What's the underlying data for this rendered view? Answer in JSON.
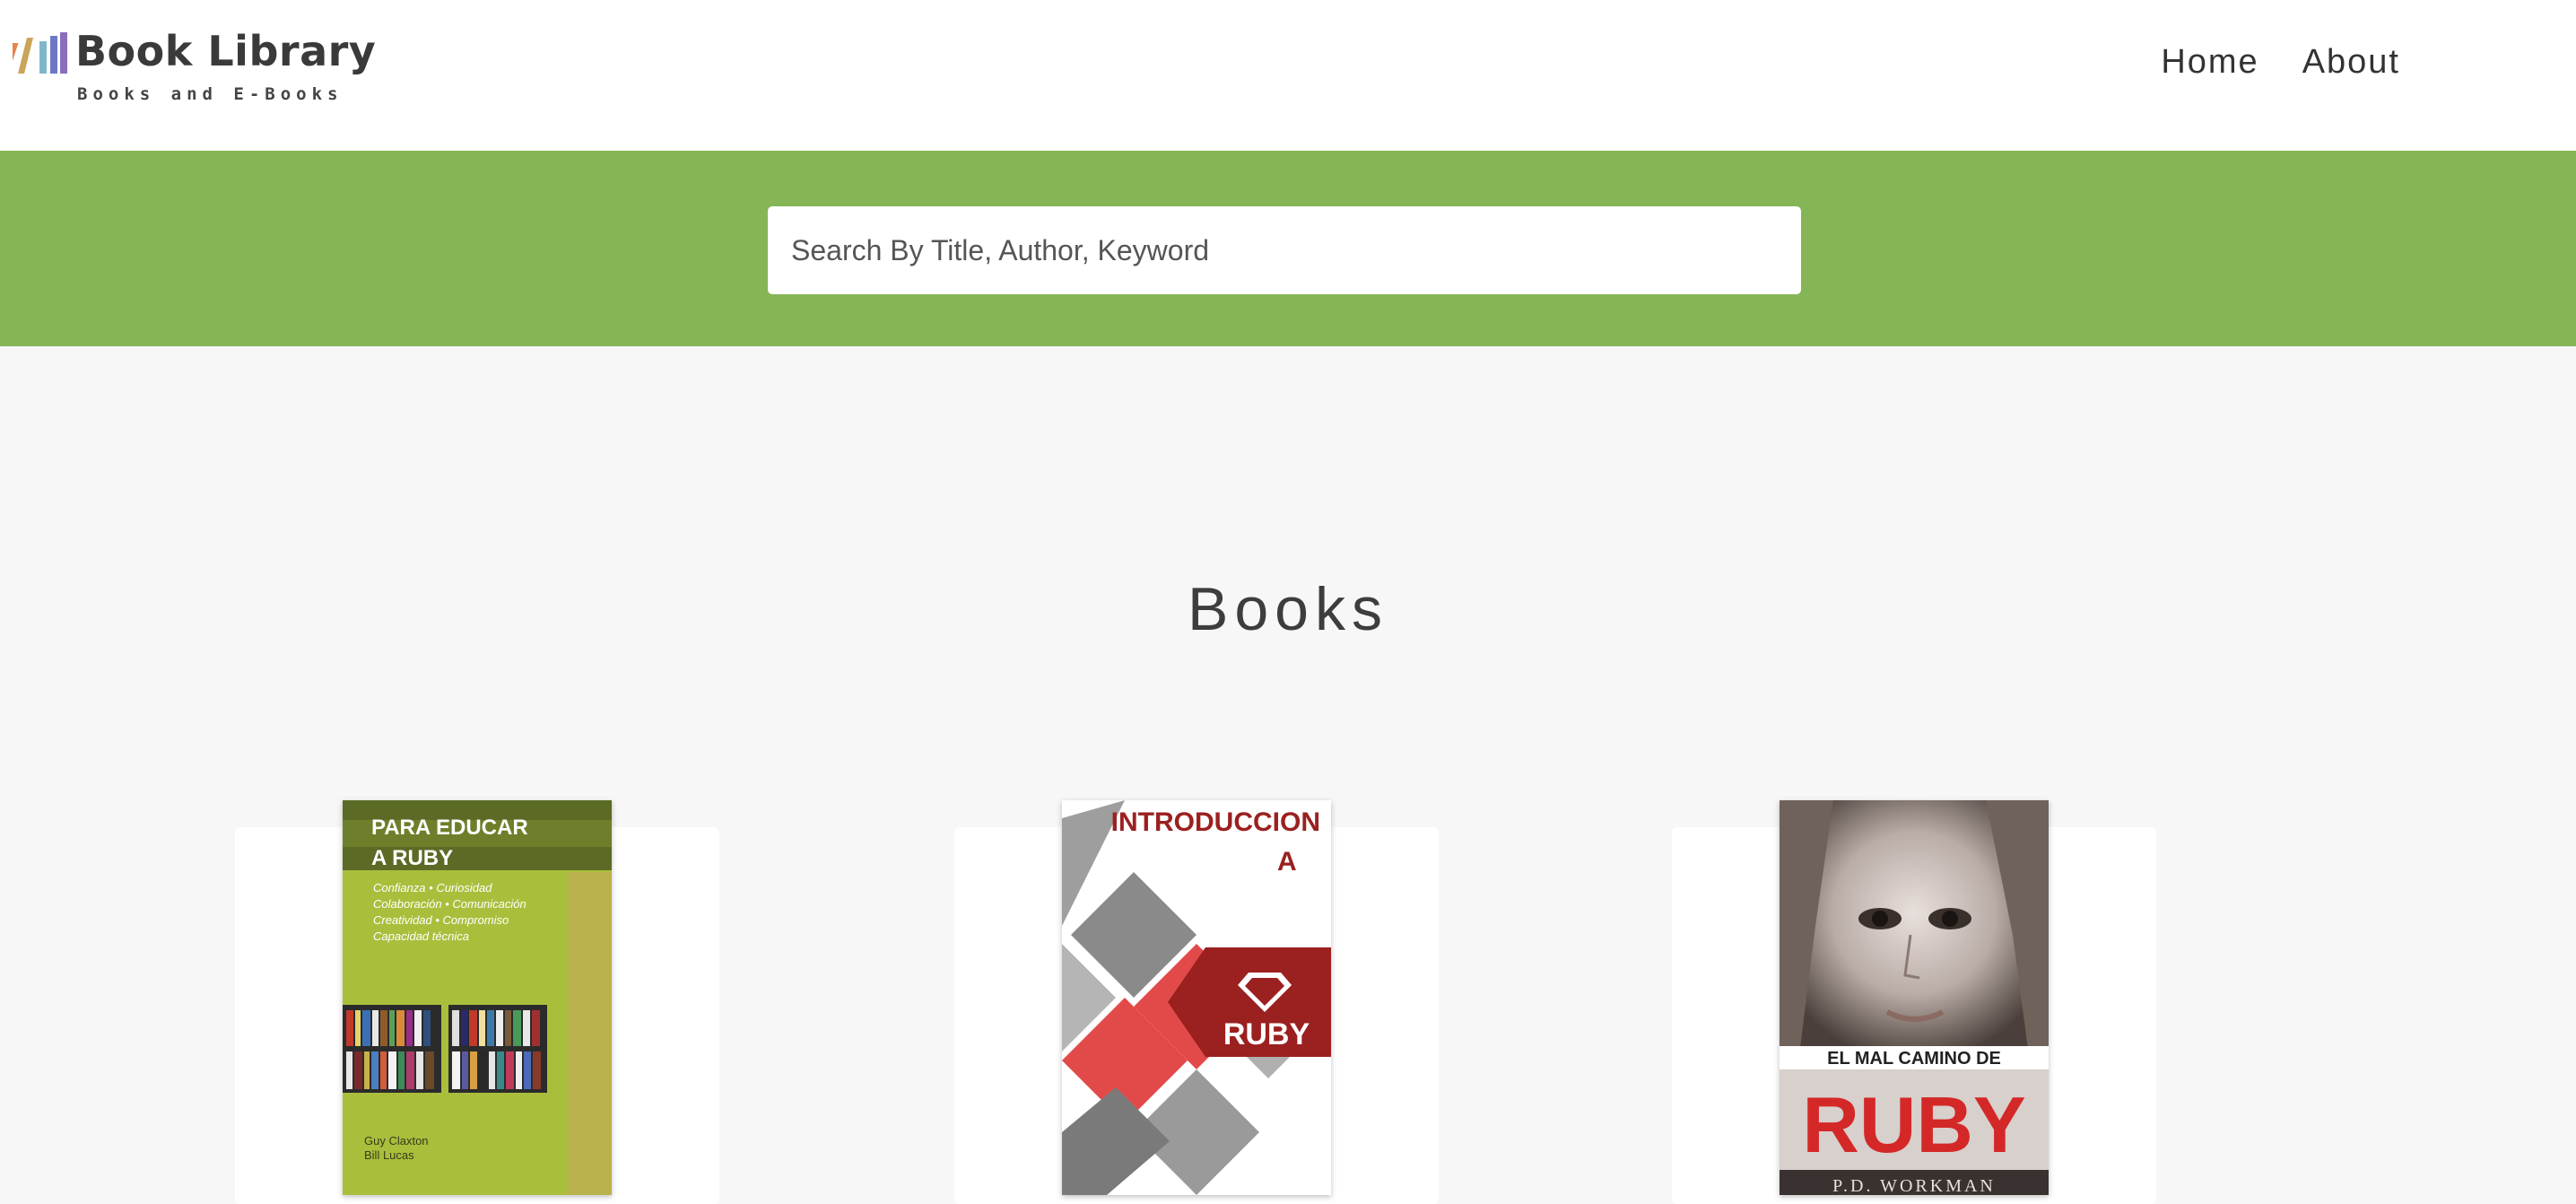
{
  "header": {
    "logo_title": "Book Library",
    "logo_subtitle": "Books and E-Books",
    "nav": {
      "home": "Home",
      "about": "About"
    }
  },
  "search": {
    "placeholder": "Search By Title, Author, Keyword"
  },
  "main": {
    "title": "Books"
  },
  "books": [
    {
      "cover_lines": [
        "PARA EDUCAR",
        "A RUBY"
      ],
      "cover_tagline": [
        "Confianza • Curiosidad",
        "Colaboración • Comunicación",
        "Creatividad • Compromiso",
        "Capacidad técnica"
      ],
      "cover_authors": [
        "Guy Claxton",
        "Bill Lucas"
      ]
    },
    {
      "cover_lines": [
        "INTRODUCCION",
        "A"
      ],
      "cover_badge": "RUBY"
    },
    {
      "cover_lines": [
        "EL MAL CAMINO DE"
      ],
      "cover_big": "RUBY",
      "cover_footer": "P.D. WORKMAN"
    }
  ],
  "colors": {
    "accent_green": "#86b556",
    "cover_red": "#9b2020"
  }
}
